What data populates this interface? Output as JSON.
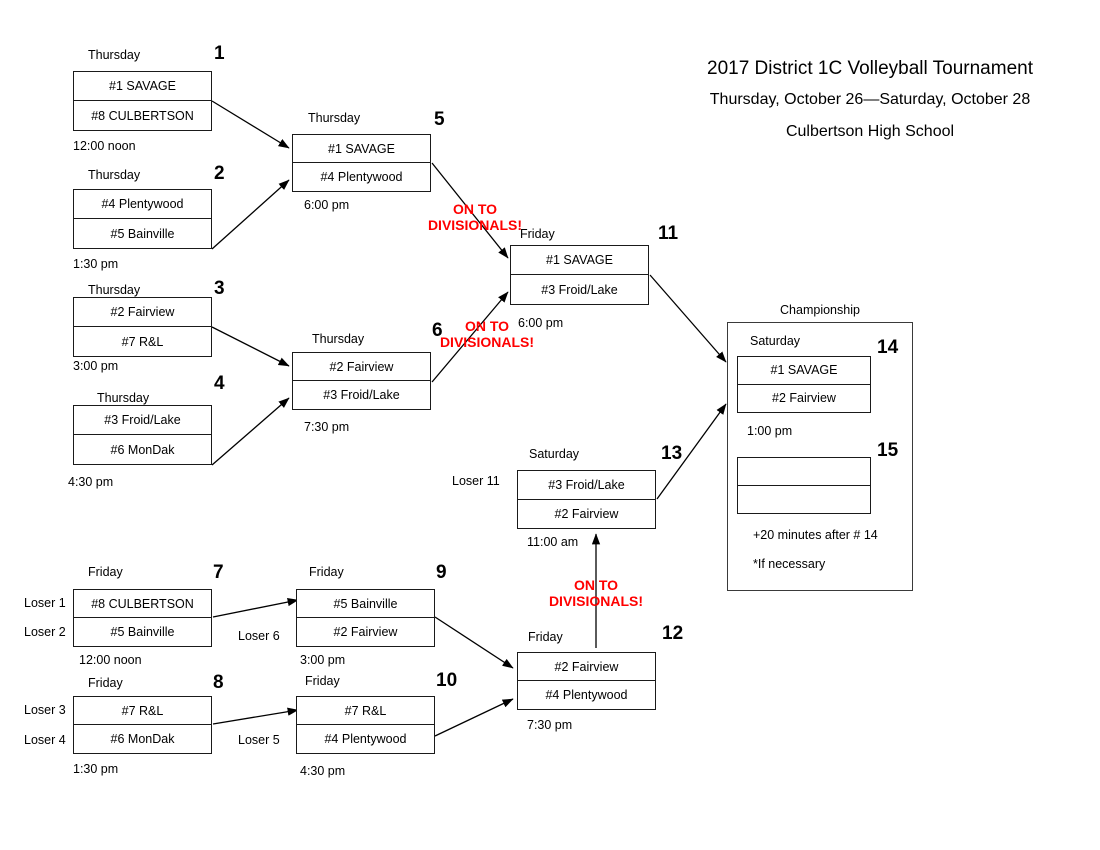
{
  "title": {
    "line1": "2017 District 1C Volleyball Tournament",
    "line2": "Thursday, October 26—Saturday, October 28",
    "line3": "Culbertson High School"
  },
  "championship": {
    "header": "Championship",
    "note_time": "+20 minutes after # 14",
    "note_if": "*If necessary"
  },
  "divisionals": [
    {
      "line1": "ON TO",
      "line2": "DIVISIONALS!"
    },
    {
      "line1": "ON TO",
      "line2": "DIVISIONALS!"
    },
    {
      "line1": "ON TO",
      "line2": "DIVISIONALS!"
    }
  ],
  "colors": {
    "divisionals_red": "#FF0000",
    "box_border": "#1a1a1a",
    "text": "#000000",
    "background": "#ffffff"
  },
  "games": [
    {
      "number": "1",
      "day": "Thursday",
      "time": "12:00 noon",
      "top_team": "#1 SAVAGE",
      "bottom_team": "#8 CULBERTSON",
      "top_feeder": "",
      "bottom_feeder": ""
    },
    {
      "number": "2",
      "day": "Thursday",
      "time": "1:30 pm",
      "top_team": "#4 Plentywood",
      "bottom_team": "#5 Bainville",
      "top_feeder": "",
      "bottom_feeder": ""
    },
    {
      "number": "3",
      "day": "Thursday",
      "time": "3:00 pm",
      "top_team": "#2 Fairview",
      "bottom_team": "#7 R&L",
      "top_feeder": "",
      "bottom_feeder": ""
    },
    {
      "number": "4",
      "day": "Thursday",
      "time": "4:30 pm",
      "top_team": "#3 Froid/Lake",
      "bottom_team": "#6 MonDak",
      "top_feeder": "",
      "bottom_feeder": ""
    },
    {
      "number": "5",
      "day": "Thursday",
      "time": "6:00 pm",
      "top_team": "#1 SAVAGE",
      "bottom_team": "#4 Plentywood",
      "top_feeder": "",
      "bottom_feeder": ""
    },
    {
      "number": "6",
      "day": "Thursday",
      "time": "7:30 pm",
      "top_team": "#2 Fairview",
      "bottom_team": "#3 Froid/Lake",
      "top_feeder": "",
      "bottom_feeder": ""
    },
    {
      "number": "7",
      "day": "Friday",
      "time": "12:00 noon",
      "top_team": "#8 CULBERTSON",
      "bottom_team": "#5 Bainville",
      "top_feeder": "Loser 1",
      "bottom_feeder": "Loser 2"
    },
    {
      "number": "8",
      "day": "Friday",
      "time": "1:30 pm",
      "top_team": "#7 R&L",
      "bottom_team": "#6 MonDak",
      "top_feeder": "Loser 3",
      "bottom_feeder": "Loser 4"
    },
    {
      "number": "9",
      "day": "Friday",
      "time": "3:00 pm",
      "top_team": "#5 Bainville",
      "bottom_team": "#2 Fairview",
      "top_feeder": "",
      "bottom_feeder": "Loser 6"
    },
    {
      "number": "10",
      "day": "Friday",
      "time": "4:30 pm",
      "top_team": "#7 R&L",
      "bottom_team": "#4 Plentywood",
      "top_feeder": "",
      "bottom_feeder": "Loser 5"
    },
    {
      "number": "11",
      "day": "Friday",
      "time": "6:00 pm",
      "top_team": "#1 SAVAGE",
      "bottom_team": "#3 Froid/Lake",
      "top_feeder": "",
      "bottom_feeder": ""
    },
    {
      "number": "12",
      "day": "Friday",
      "time": "7:30 pm",
      "top_team": "#2 Fairview",
      "bottom_team": "#4 Plentywood",
      "top_feeder": "",
      "bottom_feeder": ""
    },
    {
      "number": "13",
      "day": "Saturday",
      "time": "11:00 am",
      "top_team": "#3 Froid/Lake",
      "bottom_team": "#2 Fairview",
      "top_feeder": "Loser 11",
      "bottom_feeder": ""
    },
    {
      "number": "14",
      "day": "Saturday",
      "time": "1:00 pm",
      "top_team": "#1 SAVAGE",
      "bottom_team": "#2 Fairview",
      "top_feeder": "",
      "bottom_feeder": ""
    },
    {
      "number": "15",
      "day": "",
      "time": "",
      "top_team": "",
      "bottom_team": "",
      "top_feeder": "",
      "bottom_feeder": ""
    }
  ]
}
